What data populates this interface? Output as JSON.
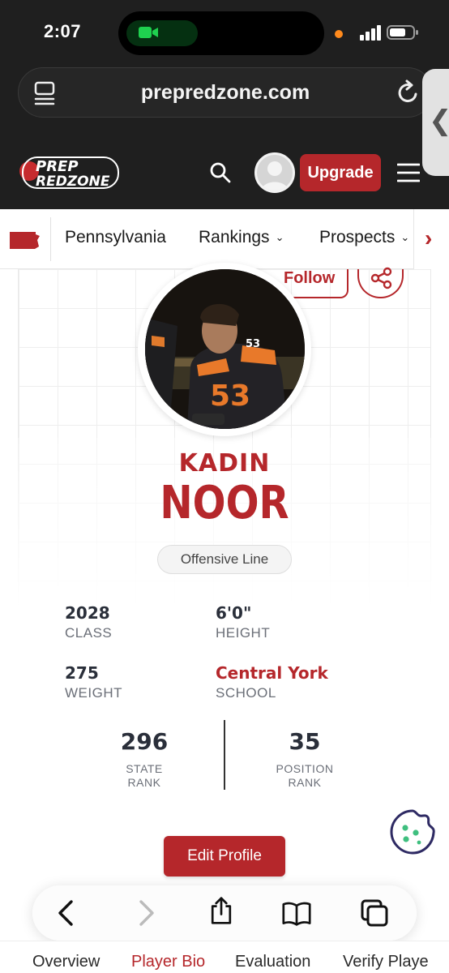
{
  "status_bar": {
    "time": "2:07"
  },
  "browser": {
    "url": "prepredzone.com"
  },
  "site_header": {
    "logo_text_line1": "PREP",
    "logo_text_line2": "REDZONE",
    "upgrade_label": "Upgrade"
  },
  "state_nav": {
    "items": [
      {
        "label": "Pennsylvania",
        "has_dropdown": false
      },
      {
        "label": "Rankings",
        "has_dropdown": true
      },
      {
        "label": "Prospects",
        "has_dropdown": true
      }
    ]
  },
  "profile": {
    "follow_label": "Follow",
    "first_name": "KADIN",
    "last_name": "NOOR",
    "position": "Offensive Line",
    "stats": [
      {
        "value": "2028",
        "label": "CLASS"
      },
      {
        "value": "6'0\"",
        "label": "HEIGHT"
      },
      {
        "value": "275",
        "label": "WEIGHT"
      },
      {
        "value": "Central York",
        "label": "SCHOOL"
      }
    ],
    "state_rank": {
      "value": "296",
      "label_line1": "STATE",
      "label_line2": "RANK"
    },
    "position_rank": {
      "value": "35",
      "label_line1": "POSITION",
      "label_line2": "RANK"
    },
    "edit_label": "Edit Profile"
  },
  "bottom_tabs": [
    {
      "label": "Overview",
      "active": false
    },
    {
      "label": "Player Bio",
      "active": true
    },
    {
      "label": "Evaluation",
      "active": false
    },
    {
      "label": "Verify Playe",
      "active": false
    }
  ],
  "colors": {
    "brand_red": "#b5272b",
    "chrome_dark": "#1f1f1f"
  },
  "icons": [
    "video-camera-icon",
    "tabs-icon",
    "reload-icon",
    "search-icon",
    "menu-icon",
    "share-icon",
    "cookie-icon",
    "back-icon",
    "forward-icon",
    "share-sheet-icon",
    "bookmarks-icon",
    "tabs-overview-icon"
  ]
}
